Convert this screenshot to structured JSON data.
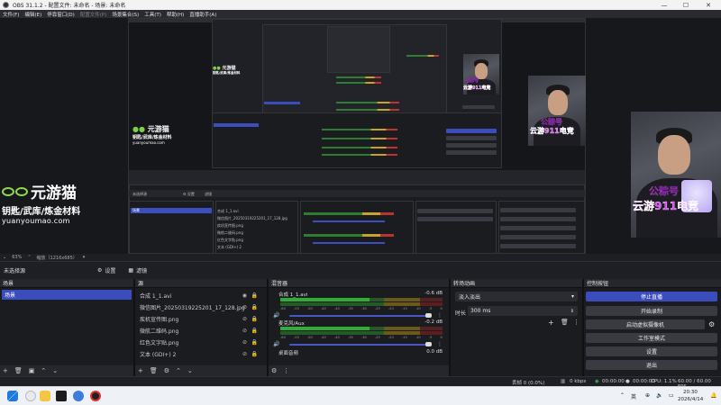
{
  "window": {
    "title": "OBS 31.1.2 - 配置文件: 未命名 - 场景: 未命名",
    "minimize": "—",
    "maximize": "☐",
    "close": "✕"
  },
  "menu": [
    {
      "label": "文件(F)",
      "enabled": true
    },
    {
      "label": "编辑(E)",
      "enabled": true
    },
    {
      "label": "停靠窗口(D)",
      "enabled": true
    },
    {
      "label": "配置文件(P)",
      "enabled": false
    },
    {
      "label": "场景集合(S)",
      "enabled": true
    },
    {
      "label": "工具(T)",
      "enabled": true
    },
    {
      "label": "帮助(H)",
      "enabled": true
    },
    {
      "label": "直播助手(A)",
      "enabled": true
    }
  ],
  "preview": {
    "logo_brand": "元游猫",
    "logo_sub": "钥匙/武库/炼金材料",
    "logo_url": "yuanyoumao.com",
    "tag_line1": "公粽号",
    "tag_line2": "云游911电竞"
  },
  "preview_status": {
    "zoom": "63%",
    "size": "缩放（1216x685）"
  },
  "scene_toolbar": {
    "current": "未选择源",
    "properties": "设置",
    "filters": "滤镜"
  },
  "docks": {
    "scenes": {
      "title": "场景",
      "items": [
        "场景"
      ]
    },
    "sources": {
      "title": "源",
      "items": [
        "合成 1_1.avi",
        "微信图片_20250319225201_17_128.jpg",
        "疾机宣传图.png",
        "微航二维码.png",
        "红色文字贴.png",
        "文本 (GDI+) 2"
      ]
    },
    "mixer": {
      "title": "混音器",
      "channels": [
        {
          "name": "合成 1_1.avi",
          "db": "-0.6 dB",
          "level": 0.55
        },
        {
          "name": "麦克风/Aux",
          "db": "-0.2 dB",
          "level": 0.55
        },
        {
          "name": "桌面音频",
          "db": "0.0 dB",
          "level": 0
        }
      ],
      "ticks": [
        "-60",
        "-55",
        "-50",
        "-45",
        "-40",
        "-35",
        "-30",
        "-25",
        "-20",
        "-15",
        "-10",
        "-5",
        "0"
      ]
    },
    "transitions": {
      "title": "转场动画",
      "selected": "淡入淡出",
      "duration_label": "时长",
      "duration_value": "300 ms"
    },
    "controls": {
      "title": "控制按钮",
      "buttons": [
        {
          "label": "停止直播",
          "active": true
        },
        {
          "label": "开始录制",
          "active": false
        },
        {
          "label": "启动虚拟摄像机",
          "active": false
        },
        {
          "label": "工作室模式",
          "active": false
        },
        {
          "label": "设置",
          "active": false
        },
        {
          "label": "退出",
          "active": false
        }
      ]
    }
  },
  "statusbar": {
    "dropped": "丢帧 0 (0.0%)",
    "bitrate": "0 kbps",
    "live_time": "00:00:00",
    "rec_time": "00:00:00",
    "cpu": "CPU: 1.1%",
    "fps": "60.00 / 60.00 FPS"
  },
  "taskbar": {
    "ime": "英",
    "time": "20:30",
    "date": "2026/4/14"
  },
  "colors": {
    "accent": "#3b4dbd",
    "panel": "#1b1c20",
    "meter_green": "#2fae37",
    "meter_yellow": "#c9a227",
    "meter_red": "#b33333"
  }
}
